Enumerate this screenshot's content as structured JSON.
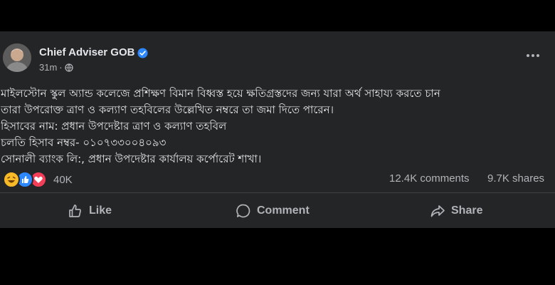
{
  "post": {
    "author": "Chief Adviser GOB",
    "time": "31m",
    "separator": "·",
    "text_lines": [
      "মাইলস্টোন স্কুল অ্যান্ড কলেজে প্রশিক্ষণ বিমান বিধ্বস্ত হয়ে ক্ষতিগ্রস্তদের জন্য যারা অর্থ সাহায্য করতে চান",
      "তারা উপরোক্ত ত্রাণ ও কল্যাণ তহবিলের উল্লেখিত নম্বরে তা জমা দিতে পারেন।",
      "হিসাবের নাম: প্রধান উপদেষ্টার ত্রাণ ও কল্যাণ তহবিল",
      "চলতি হিসাব নম্বর- ০১০৭৩৩০০৪০৯৩",
      "সোনালী ব্যাংক লি:, প্রধান উপদেষ্টার কার্যালয় কর্পোরেট শাখা।"
    ]
  },
  "stats": {
    "reaction_count": "40K",
    "comments": "12.4K comments",
    "shares": "9.7K shares"
  },
  "actions": {
    "like": "Like",
    "comment": "Comment",
    "share": "Share"
  },
  "icons": {
    "verified": "verified-badge-icon",
    "audience": "globe-icon",
    "more": "more-options-icon",
    "reactions": [
      "haha-icon",
      "like-icon",
      "love-icon"
    ]
  },
  "colors": {
    "card_bg": "#242526",
    "page_bg": "#000000",
    "text_primary": "#e4e6eb",
    "text_secondary": "#b0b3b8",
    "verified_blue": "#2d88ff",
    "love_red": "#f33e58",
    "haha_yellow": "#f7b928"
  }
}
